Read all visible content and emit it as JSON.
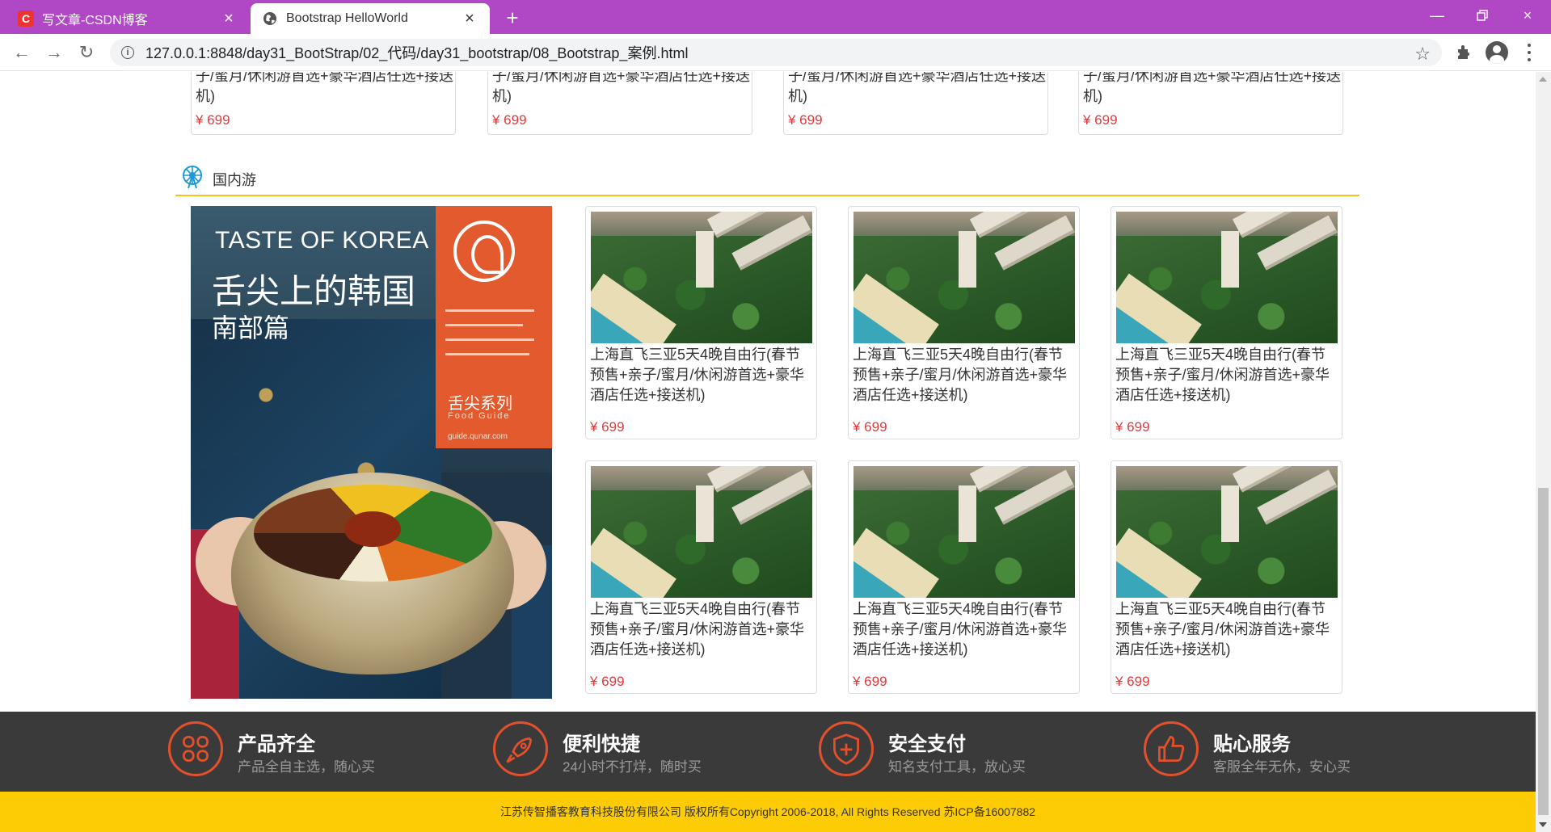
{
  "browser": {
    "tabs": [
      {
        "title": "写文章-CSDN博客",
        "favicon": "csdn-icon",
        "active": false
      },
      {
        "title": "Bootstrap HelloWorld",
        "favicon": "globe-icon",
        "active": true
      }
    ],
    "url": "127.0.0.1:8848/day31_BootStrap/02_代码/day31_bootstrap/08_Bootstrap_案例.html",
    "accent_color": "#b048c6"
  },
  "top_products": [
    {
      "title_tail": "子/蜜月/休闲游首选+豪华酒店任选+接送",
      "title_end": "机)",
      "price": "¥ 699"
    },
    {
      "title_tail": "子/蜜月/休闲游首选+豪华酒店任选+接送",
      "title_end": "机)",
      "price": "¥ 699"
    },
    {
      "title_tail": "子/蜜月/休闲游首选+豪华酒店任选+接送",
      "title_end": "机)",
      "price": "¥ 699"
    },
    {
      "title_tail": "子/蜜月/休闲游首选+豪华酒店任选+接送",
      "title_end": "机)",
      "price": "¥ 699"
    }
  ],
  "section": {
    "title": "国内游",
    "icon": "ferris-wheel-icon",
    "accent_color": "#f4c21a"
  },
  "poster": {
    "en_title": "TASTE OF KOREA",
    "cn_title": "舌尖上的韩国",
    "subtitle": "南部篇",
    "series": "舌尖系列",
    "series_en": "Food Guide",
    "site": "guide.qunar.com"
  },
  "products": [
    {
      "title": "上海直飞三亚5天4晚自由行(春节预售+亲子/蜜月/休闲游首选+豪华酒店任选+接送机)",
      "price": "¥ 699"
    },
    {
      "title": "上海直飞三亚5天4晚自由行(春节预售+亲子/蜜月/休闲游首选+豪华酒店任选+接送机)",
      "price": "¥ 699"
    },
    {
      "title": "上海直飞三亚5天4晚自由行(春节预售+亲子/蜜月/休闲游首选+豪华酒店任选+接送机)",
      "price": "¥ 699"
    },
    {
      "title": "上海直飞三亚5天4晚自由行(春节预售+亲子/蜜月/休闲游首选+豪华酒店任选+接送机)",
      "price": "¥ 699"
    },
    {
      "title": "上海直飞三亚5天4晚自由行(春节预售+亲子/蜜月/休闲游首选+豪华酒店任选+接送机)",
      "price": "¥ 699"
    },
    {
      "title": "上海直飞三亚5天4晚自由行(春节预售+亲子/蜜月/休闲游首选+豪华酒店任选+接送机)",
      "price": "¥ 699"
    }
  ],
  "services": [
    {
      "title": "产品齐全",
      "desc": "产品全自主选，随心买",
      "icon": "grid-icon"
    },
    {
      "title": "便利快捷",
      "desc": "24小时不打烊，随时买",
      "icon": "rocket-icon"
    },
    {
      "title": "安全支付",
      "desc": "知名支付工具，放心买",
      "icon": "shield-icon"
    },
    {
      "title": "贴心服务",
      "desc": "客服全年无休，安心买",
      "icon": "thumbs-up-icon"
    }
  ],
  "footer": {
    "text": "江苏传智播客教育科技股份有限公司 版权所有Copyright 2006-2018, All Rights Reserved 苏ICP备16007882"
  },
  "colors": {
    "price": "#e4393c",
    "services_bg": "#3a3a3a",
    "services_icon": "#e4502b",
    "footer_bg": "#fecc04"
  }
}
